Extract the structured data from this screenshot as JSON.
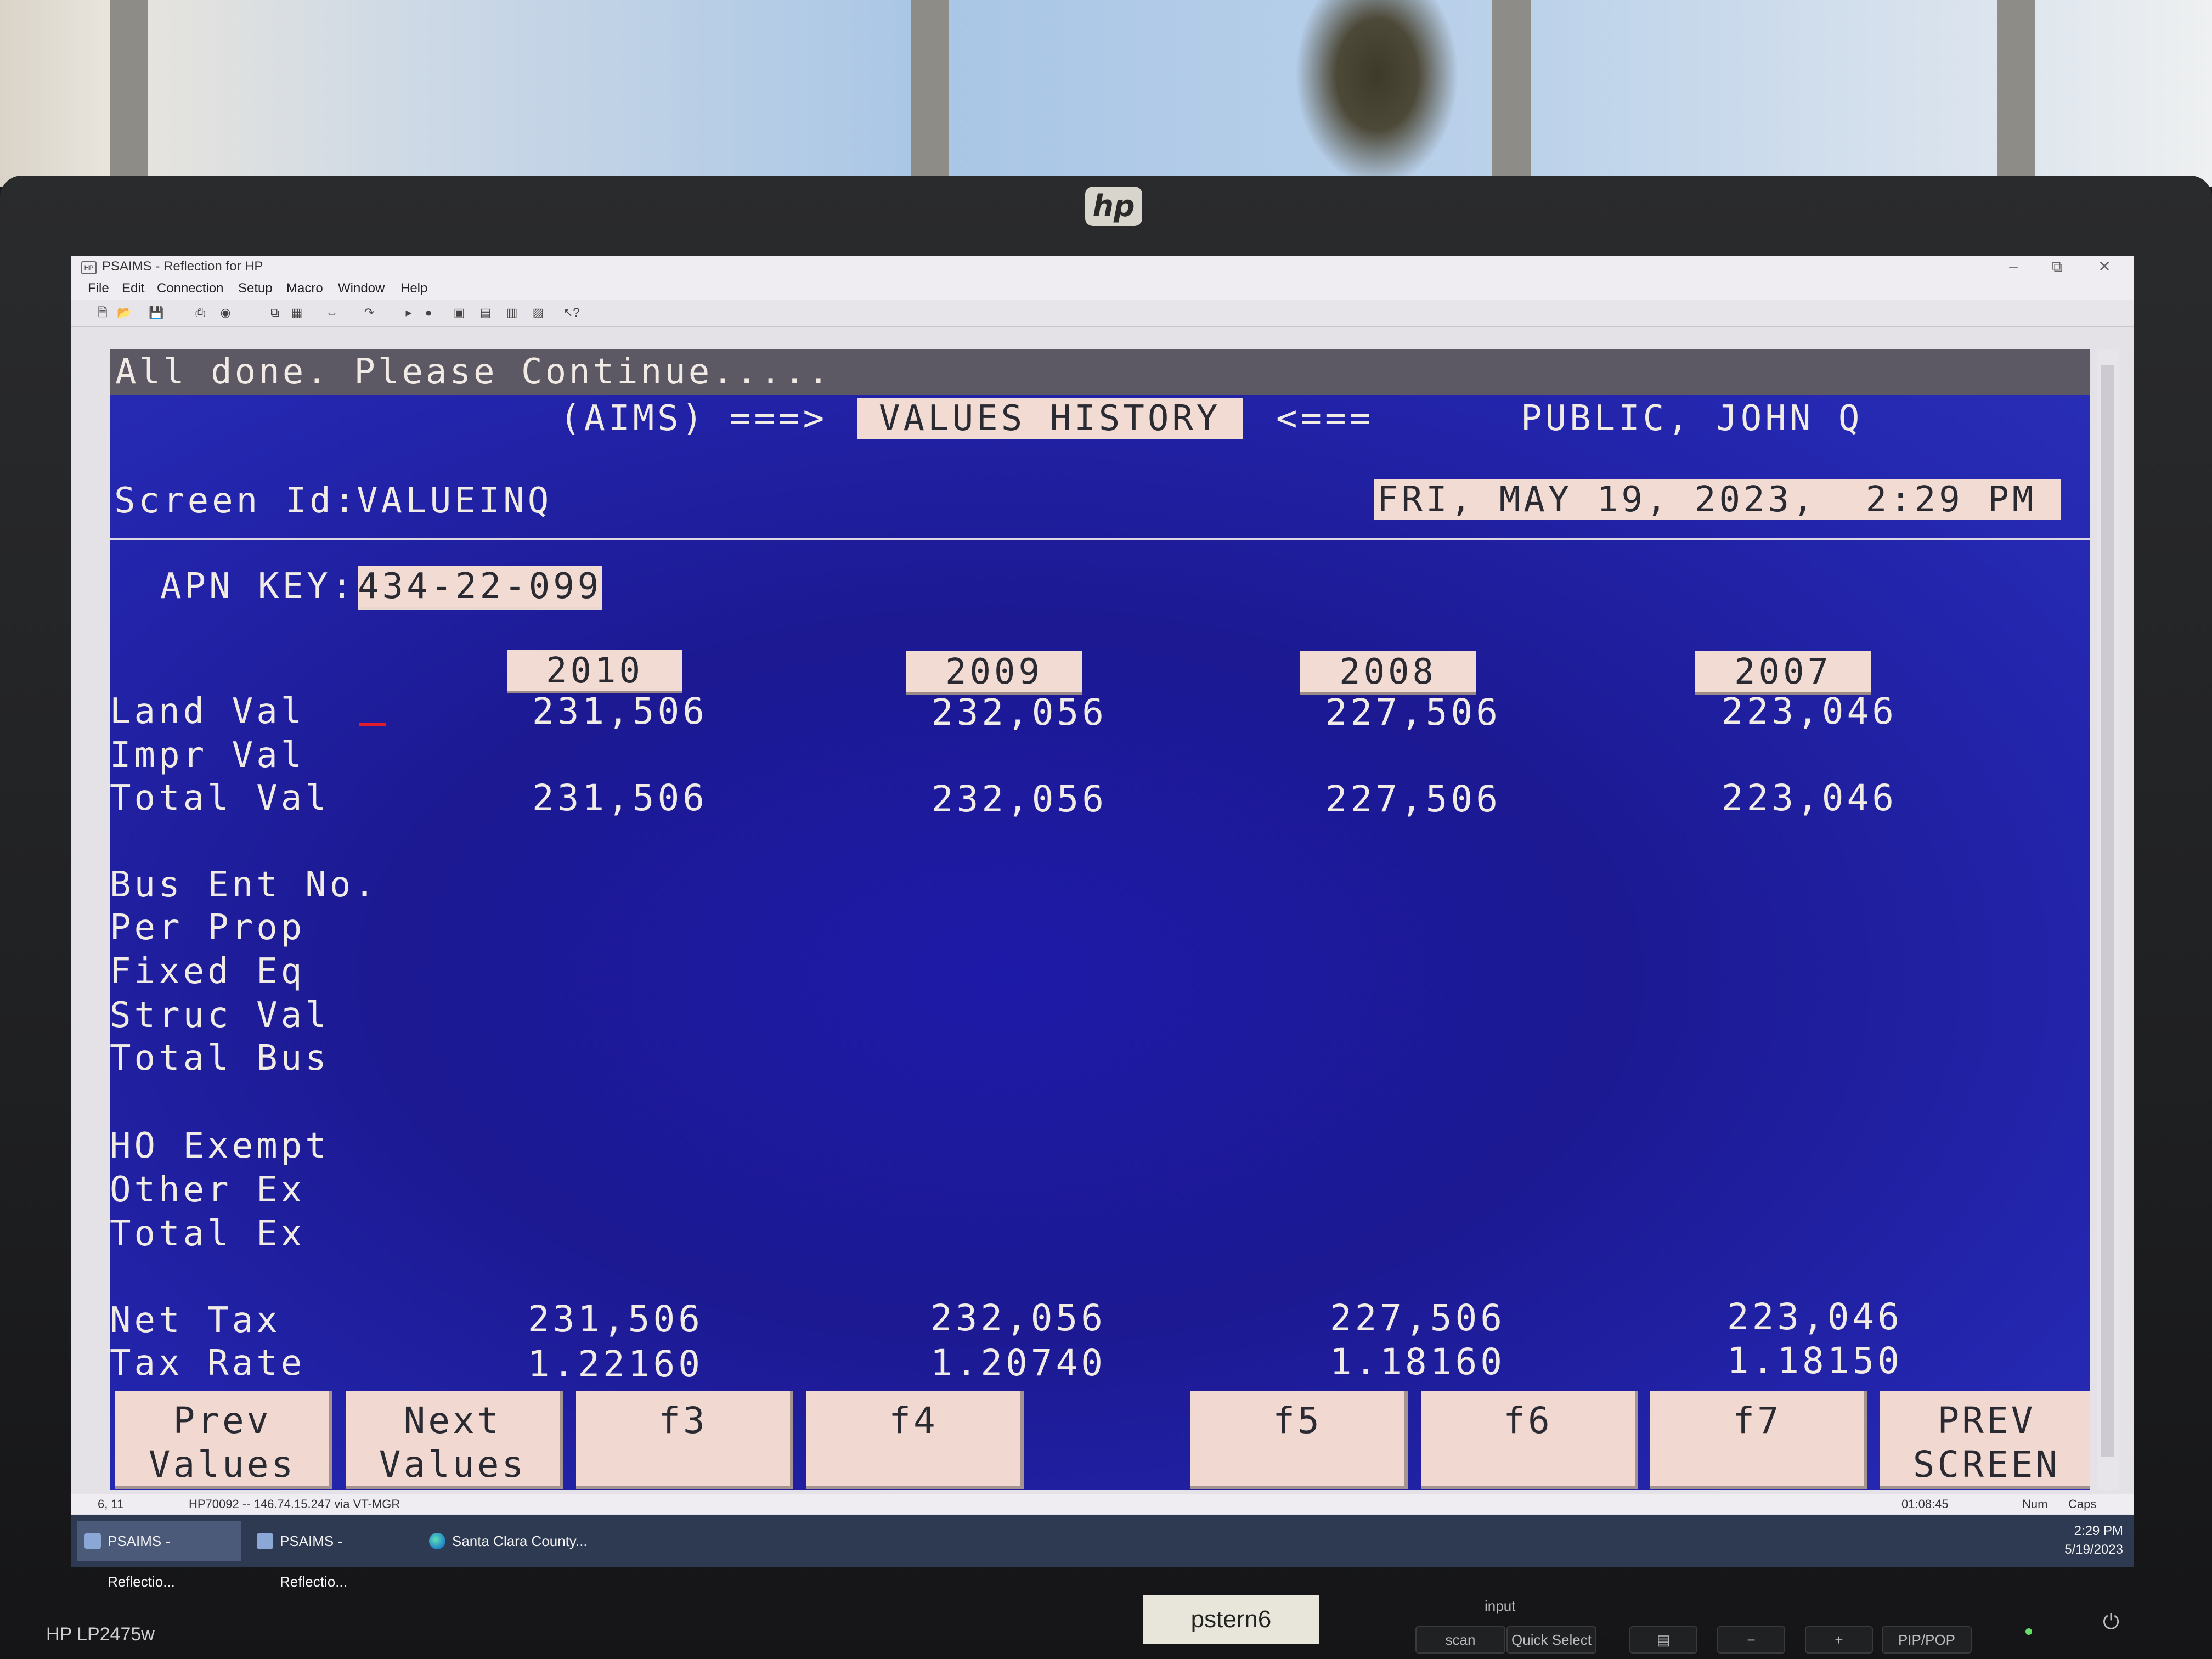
{
  "window": {
    "title": "PSAIMS - Reflection for HP",
    "menu": [
      "File",
      "Edit",
      "Connection",
      "Setup",
      "Macro",
      "Window",
      "Help"
    ]
  },
  "terminal": {
    "message": "All done.  Please Continue.....",
    "header": {
      "aims": "(AIMS)",
      "arrow_right": "===>",
      "screen_title": "VALUES HISTORY",
      "arrow_left": "<===",
      "owner": "PUBLIC, JOHN Q"
    },
    "screen_id_label": "Screen Id:",
    "screen_id": "VALUEINQ",
    "datetime": "FRI, MAY 19, 2023,  2:29 PM",
    "apn_label": "APN KEY:",
    "apn_value": "434-22-099",
    "years": [
      "2010",
      "2009",
      "2008",
      "2007"
    ],
    "rows": {
      "land_val": {
        "label": "Land Val",
        "values": [
          "231,506",
          "232,056",
          "227,506",
          "223,046"
        ]
      },
      "impr_val": {
        "label": "Impr Val"
      },
      "total_val": {
        "label": "Total Val",
        "values": [
          "231,506",
          "232,056",
          "227,506",
          "223,046"
        ]
      },
      "bus_ent_no": {
        "label": "Bus Ent No."
      },
      "per_prop": {
        "label": "Per Prop"
      },
      "fixed_eq": {
        "label": "Fixed Eq"
      },
      "struc_val": {
        "label": "Struc Val"
      },
      "total_bus": {
        "label": "Total Bus"
      },
      "ho_exempt": {
        "label": "HO Exempt"
      },
      "other_ex": {
        "label": "Other Ex"
      },
      "total_ex": {
        "label": "Total Ex"
      },
      "net_tax": {
        "label": "Net Tax",
        "values": [
          "231,506",
          "232,056",
          "227,506",
          "223,046"
        ]
      },
      "tax_rate": {
        "label": "Tax Rate",
        "values": [
          "1.22160",
          "1.20740",
          "1.18160",
          "1.18150"
        ]
      }
    },
    "function_keys": {
      "f1": "Prev\nValues",
      "f2": "Next\nValues",
      "f3": "f3",
      "f4": "f4",
      "f5": "f5",
      "f6": "f6",
      "f7": "f7",
      "f8": "PREV\nSCREEN"
    }
  },
  "statusbar": {
    "cursor": "6, 11",
    "host": "HP70092 -- 146.74.15.247 via VT-MGR",
    "timer": "01:08:45",
    "num": "Num",
    "caps": "Caps"
  },
  "taskbar": {
    "items": [
      "PSAIMS - Reflectio...",
      "PSAIMS - Reflectio...",
      "Santa Clara County..."
    ],
    "time": "2:29 PM",
    "date": "5/19/2023"
  },
  "monitor": {
    "brand_logo": "hp",
    "model": "HP LP2475w",
    "display_label": "pstern6",
    "input_label": "input",
    "buttons": [
      "scan",
      "Quick Select",
      "PIP/POP"
    ]
  }
}
